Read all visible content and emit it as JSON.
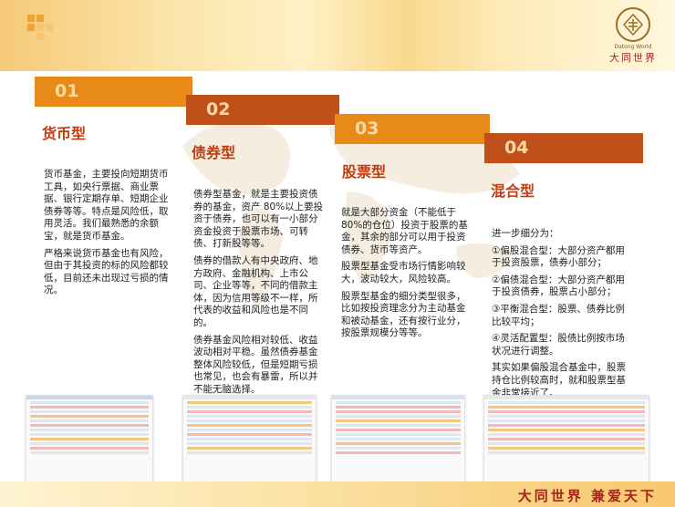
{
  "header": {
    "logo": {
      "icon": "datong-world-logo-icon",
      "en": "Datong World",
      "cn": "大同世界"
    }
  },
  "sections": [
    {
      "num": "01",
      "title": "货币型",
      "paragraphs": [
        "货币基金，主要投向短期货币工具，如央行票据、商业票据、银行定期存单、短期企业债券等等。特点是风险低，取用灵活。我们最熟悉的余额宝，就是货币基金。",
        "严格来说货币基金也有风险，但由于其投资的标的风险都较低，目前还未出现过亏损的情况。"
      ]
    },
    {
      "num": "02",
      "title": "债券型",
      "paragraphs": [
        "债券型基金，就是主要投资债券的基金，资产 80%以上要投资于债券，也可以有一小部分资金投资于股票市场、可转债、打新股等等。",
        "债券的借款人有中央政府、地方政府、金融机构、上市公司、企业等等，不同的借款主体，因为信用等级不一样，所代表的收益和风险也是不同的。",
        "债券基金风险相对较低、收益波动相对平稳。虽然债券基金整体风险较低，但是短期亏损也常见，也会有暴雷，所以并不能无脑选择。"
      ]
    },
    {
      "num": "03",
      "title": "股票型",
      "paragraphs": [
        "就是大部分资金（不能低于80%的仓位）投资于股票的基金，其余的部分可以用于投资债券、货币等资产。",
        "股票型基金受市场行情影响较大，波动较大，风险较高。",
        "股票型基金的细分类型很多，比如按投资理念分为主动基金和被动基金，还有按行业分，按股票规模分等等。"
      ]
    },
    {
      "num": "04",
      "title": "混合型",
      "paragraphs": [
        "进一步细分为：",
        "①偏股混合型：大部分资产都用于投资股票，债券小部分；",
        "②偏债混合型：大部分资产都用于投资债券，股票占小部分；",
        "③平衡混合型：股票、债券比例比较平均；",
        "④灵活配置型：股债比例按市场状况进行调整。",
        "其实如果偏股混合基金中，股票持仓比例较高时，就和股票型基金非常接近了。"
      ]
    }
  ],
  "footer": {
    "slogan": "大同世界 兼爱天下"
  }
}
